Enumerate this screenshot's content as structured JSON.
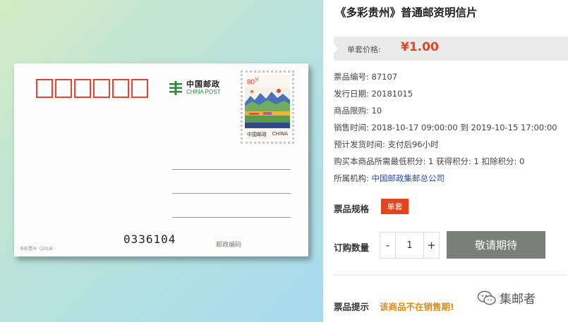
{
  "postcard": {
    "logo_cn": "中国邮政",
    "logo_en": "CHINA POST",
    "stamp_value": "80",
    "stamp_footer_left": "中国邮政",
    "stamp_footer_right": "CHINA",
    "serial_number": "0336104",
    "zip_label": "邮政编码",
    "caption": "多彩贵州（2018）",
    "zip_box_count": 6
  },
  "product": {
    "title": "《多彩贵州》普通邮资明信片",
    "price_label": "单套价格:",
    "price_value": "¥1.00",
    "details": [
      {
        "label": "票品编号:",
        "value": "87107"
      },
      {
        "label": "发行日期:",
        "value": "20181015"
      },
      {
        "label": "商品限购:",
        "value": "10"
      },
      {
        "label": "销售时间:",
        "value": "2018-10-17 09:00:00 到 2019-10-15 17:00:00"
      },
      {
        "label": "预计发货时间:",
        "value": "支付后96小时"
      },
      {
        "label": "购买本商品所需最低积分:",
        "value": "1 获得积分: 1 扣除积分: 0"
      },
      {
        "label": "所属机构:",
        "value": "中国邮政集邮总公司"
      }
    ],
    "spec_label": "票品规格",
    "spec_option": "单套",
    "qty_label": "订购数量",
    "qty_minus": "-",
    "qty_value": "1",
    "qty_plus": "+",
    "buy_button": "敬请期待",
    "tip_label": "票品提示",
    "tip_text": "该商品不在销售期!"
  },
  "watermark": {
    "text": "集邮者"
  },
  "colors": {
    "accent": "#e2451f",
    "tip": "#e08a14",
    "link": "#2b4da8",
    "button": "#7a7f7a"
  }
}
